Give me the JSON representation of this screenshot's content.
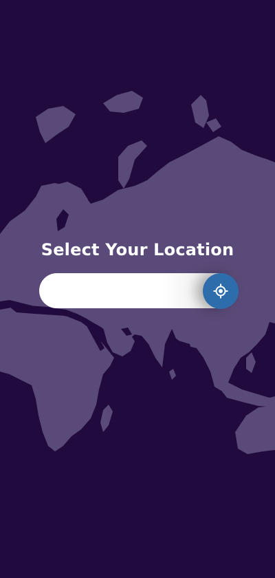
{
  "header": {
    "title": "Select Your Location"
  },
  "search": {
    "value": "",
    "placeholder": "",
    "locate_icon": "crosshair-locate-icon"
  },
  "colors": {
    "background": "#210a3e",
    "land": "#5a4a79",
    "accent": "#2e6dab",
    "text": "#ffffff"
  }
}
